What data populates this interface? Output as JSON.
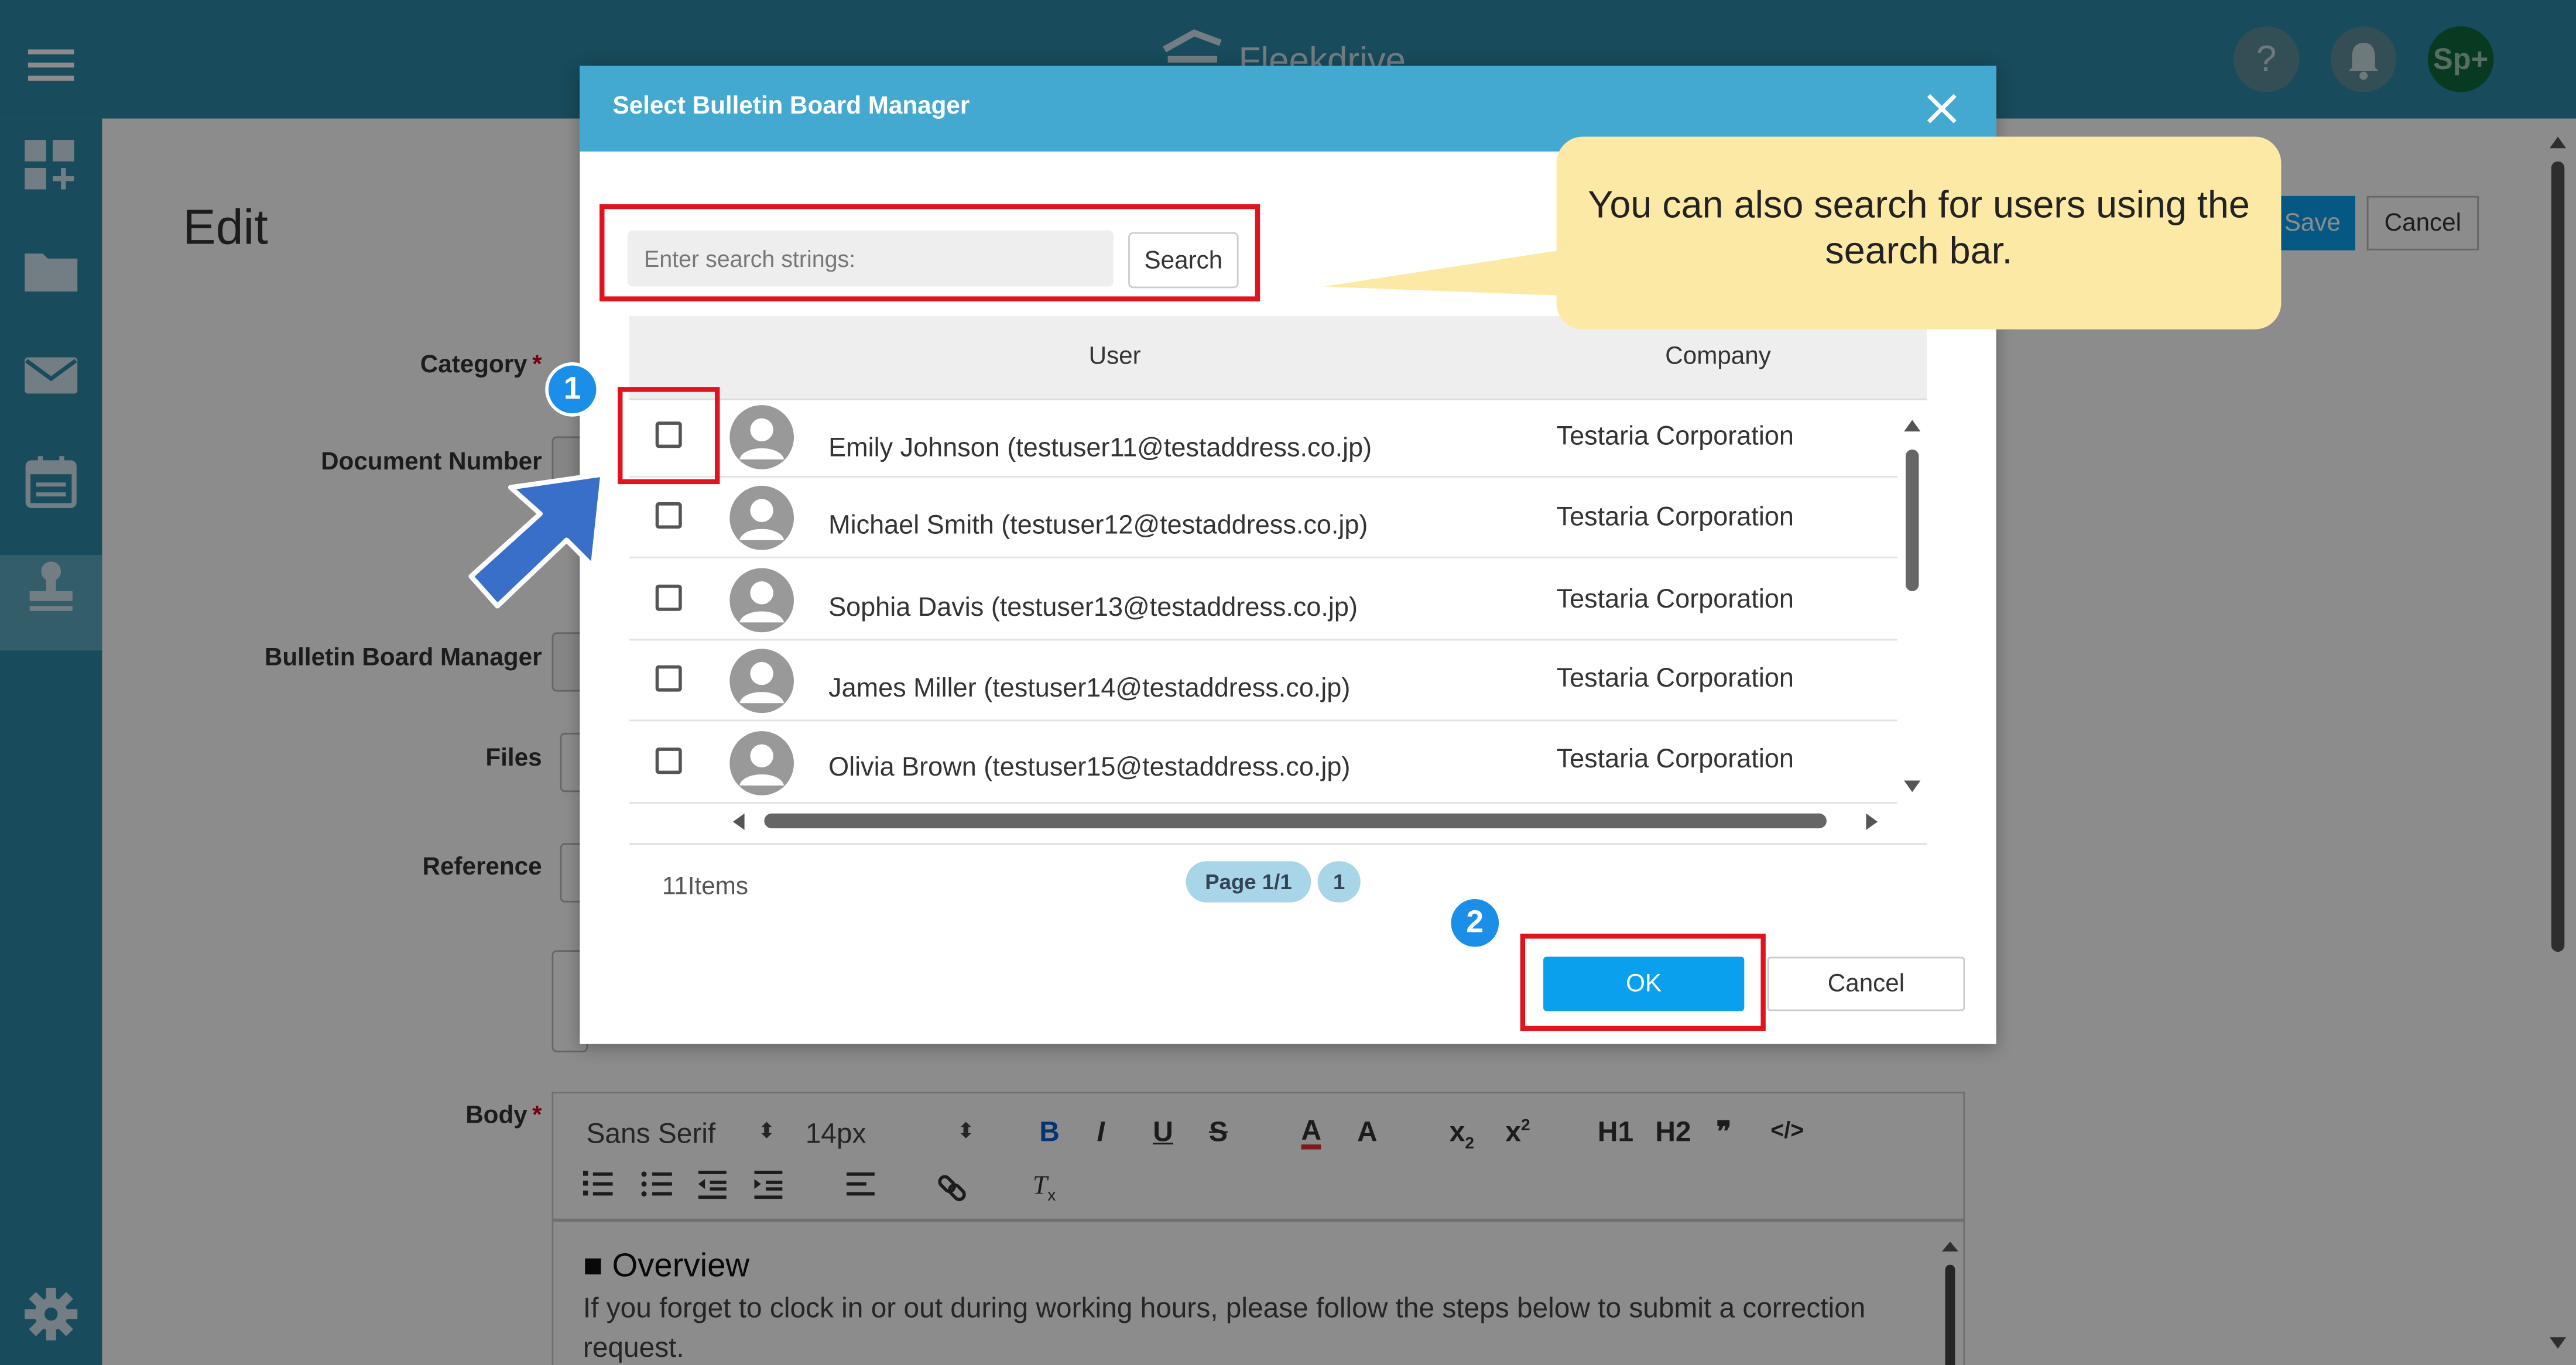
{
  "app": {
    "brand": "Fleekdrive",
    "user_initials": "Sp+",
    "help_glyph": "?"
  },
  "page": {
    "title": "Edit",
    "save_label": "Save",
    "cancel_label": "Cancel"
  },
  "form": {
    "labels": {
      "category": "Category",
      "document_number": "Document Number",
      "bulletin_board_manager": "Bulletin Board Manager",
      "files": "Files",
      "reference": "Reference",
      "body": "Body"
    },
    "required_mark": "*"
  },
  "editor": {
    "font_family": "Sans Serif",
    "font_size": "14px",
    "body_heading": "■ Overview",
    "body_text": "If you forget to clock in or out during working hours, please follow the steps below to submit a correction request."
  },
  "modal": {
    "title": "Select Bulletin Board Manager",
    "search_placeholder": "Enter search strings:",
    "search_button": "Search",
    "columns": {
      "user": "User",
      "company": "Company"
    },
    "rows": [
      {
        "user": "Emily Johnson (testuser11@testaddress.co.jp)",
        "company": "Testaria Corporation",
        "checked": false
      },
      {
        "user": "Michael Smith (testuser12@testaddress.co.jp)",
        "company": "Testaria Corporation",
        "checked": false
      },
      {
        "user": "Sophia Davis (testuser13@testaddress.co.jp)",
        "company": "Testaria Corporation",
        "checked": false
      },
      {
        "user": "James Miller (testuser14@testaddress.co.jp)",
        "company": "Testaria Corporation",
        "checked": false
      },
      {
        "user": "Olivia Brown (testuser15@testaddress.co.jp)",
        "company": "Testaria Corporation",
        "checked": false
      }
    ],
    "items_count": "11Items",
    "page_label": "Page 1/1",
    "page_number": "1",
    "ok_label": "OK",
    "cancel_label": "Cancel"
  },
  "annotations": {
    "callout_text": "You can also search for users using the search bar.",
    "step1": "1",
    "step2": "2"
  },
  "colors": {
    "header": "#2c89a6",
    "modal_header": "#44a9d1",
    "ok_button": "#0aa0ee",
    "highlight": "#e0141e",
    "badge": "#1b8ee8",
    "callout": "#fde9a6",
    "arrow": "#3a6fc9"
  }
}
